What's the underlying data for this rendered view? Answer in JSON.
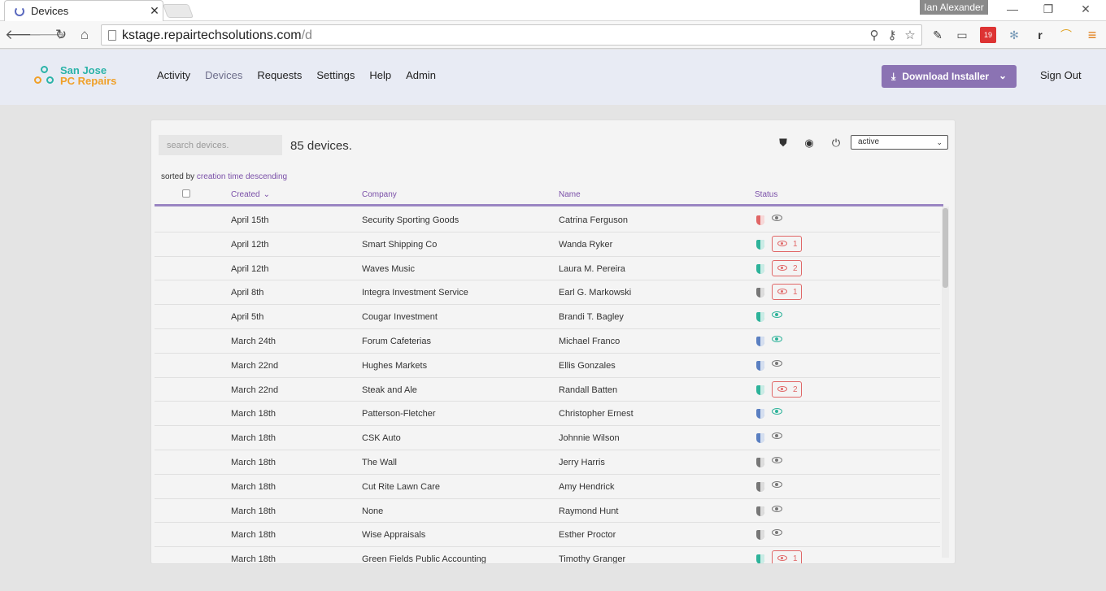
{
  "browser": {
    "tab_title": "Devices",
    "tab_close": "✕",
    "profile_name": "Ian Alexander",
    "url_host": "kstage.repairtechsolutions.com",
    "url_path": "/d",
    "ext_badge": "19",
    "ext_r": "r"
  },
  "app": {
    "logo_line1": "San Jose",
    "logo_line2": "PC Repairs",
    "nav": [
      "Activity",
      "Devices",
      "Requests",
      "Settings",
      "Help",
      "Admin"
    ],
    "download_label": "Download Installer",
    "signout_label": "Sign Out"
  },
  "devices": {
    "search_placeholder": "search devices.",
    "count_text": "85 devices.",
    "filter_value": "active",
    "sorted_prefix": "sorted by",
    "sorted_key": "creation time descending",
    "columns": {
      "created": "Created",
      "company": "Company",
      "name": "Name",
      "status": "Status"
    },
    "colors": {
      "green": "#2eb39a",
      "blue": "#5a7fc1",
      "gray": "#777777",
      "red": "#e06666",
      "accent": "#8b73b3"
    },
    "rows": [
      {
        "created": "April 15th",
        "company": "Security Sporting Goods",
        "name": "Catrina Ferguson",
        "shield": "red",
        "eye": "gray",
        "alerts": ""
      },
      {
        "created": "April 12th",
        "company": "Smart Shipping Co",
        "name": "Wanda Ryker",
        "shield": "green",
        "eye": "",
        "alerts": "1"
      },
      {
        "created": "April 12th",
        "company": "Waves Music",
        "name": "Laura M. Pereira",
        "shield": "green",
        "eye": "",
        "alerts": "2"
      },
      {
        "created": "April 8th",
        "company": "Integra Investment Service",
        "name": "Earl G. Markowski",
        "shield": "gray",
        "eye": "",
        "alerts": "1"
      },
      {
        "created": "April 5th",
        "company": "Cougar Investment",
        "name": "Brandi T. Bagley",
        "shield": "green",
        "eye": "green",
        "alerts": ""
      },
      {
        "created": "March 24th",
        "company": "Forum Cafeterias",
        "name": "Michael Franco",
        "shield": "blue",
        "eye": "green",
        "alerts": ""
      },
      {
        "created": "March 22nd",
        "company": "Hughes Markets",
        "name": "Ellis Gonzales",
        "shield": "blue",
        "eye": "gray",
        "alerts": ""
      },
      {
        "created": "March 22nd",
        "company": "Steak and Ale",
        "name": "Randall Batten",
        "shield": "green",
        "eye": "",
        "alerts": "2"
      },
      {
        "created": "March 18th",
        "company": "Patterson-Fletcher",
        "name": "Christopher Ernest",
        "shield": "blue",
        "eye": "green",
        "alerts": ""
      },
      {
        "created": "March 18th",
        "company": "CSK Auto",
        "name": "Johnnie Wilson",
        "shield": "blue",
        "eye": "gray",
        "alerts": ""
      },
      {
        "created": "March 18th",
        "company": "The Wall",
        "name": "Jerry Harris",
        "shield": "gray",
        "eye": "gray",
        "alerts": ""
      },
      {
        "created": "March 18th",
        "company": "Cut Rite Lawn Care",
        "name": "Amy Hendrick",
        "shield": "gray",
        "eye": "gray",
        "alerts": ""
      },
      {
        "created": "March 18th",
        "company": "None",
        "name": "Raymond Hunt",
        "shield": "gray",
        "eye": "gray",
        "alerts": ""
      },
      {
        "created": "March 18th",
        "company": "Wise Appraisals",
        "name": "Esther Proctor",
        "shield": "gray",
        "eye": "gray",
        "alerts": ""
      },
      {
        "created": "March 18th",
        "company": "Green Fields Public Accounting",
        "name": "Timothy Granger",
        "shield": "green",
        "eye": "",
        "alerts": "1"
      }
    ]
  }
}
